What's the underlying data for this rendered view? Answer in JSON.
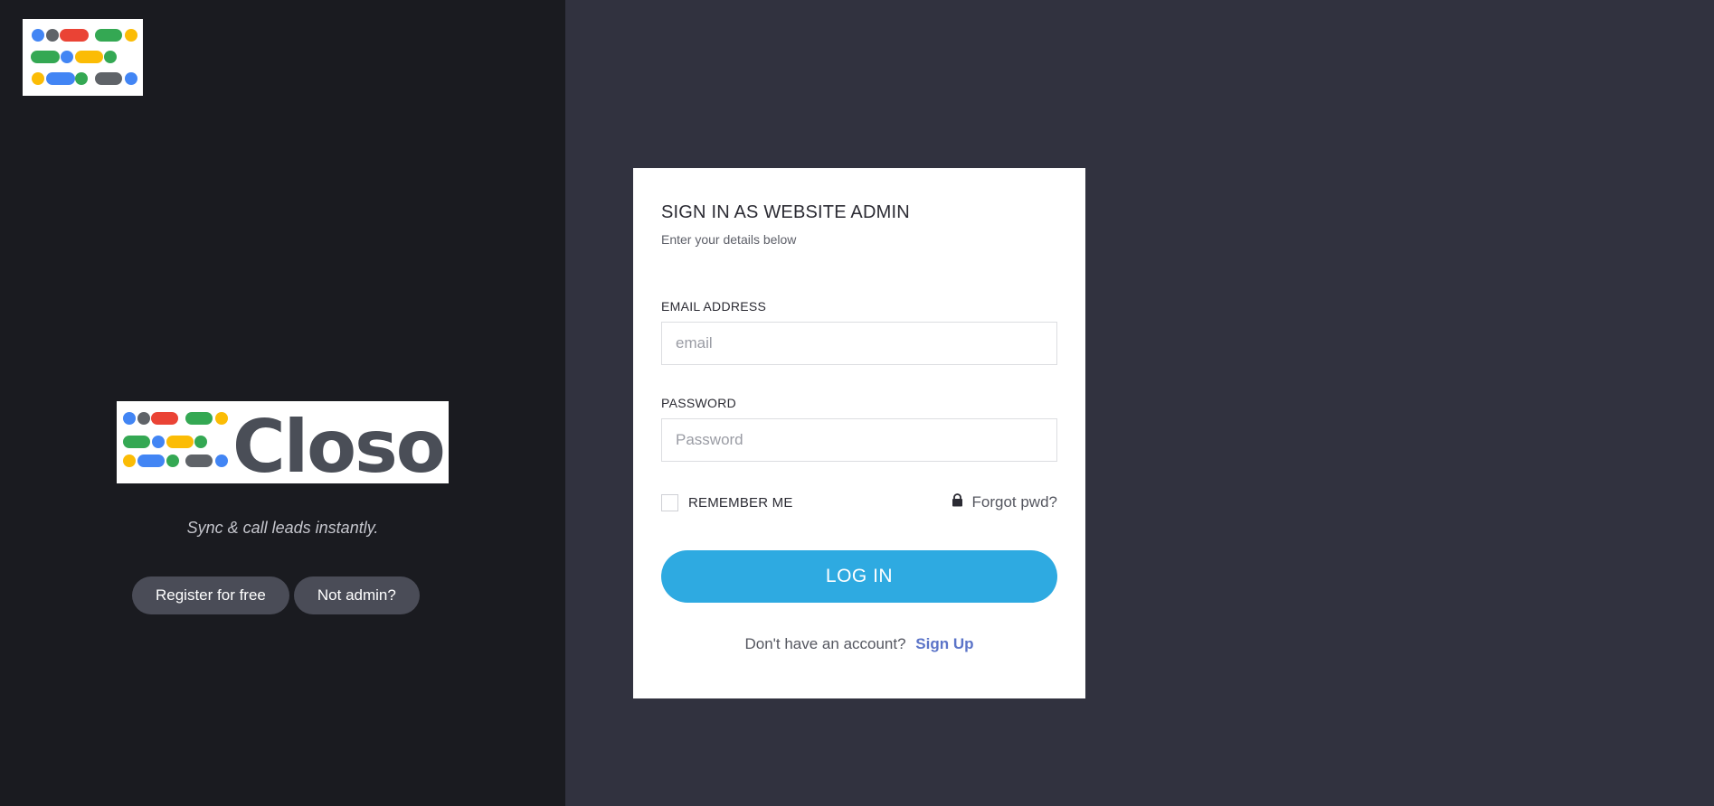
{
  "branding": {
    "brand_name": "Closor",
    "tagline": "Sync & call leads instantly."
  },
  "left_actions": {
    "register_label": "Register for free",
    "not_admin_label": "Not admin?"
  },
  "login_form": {
    "title": "SIGN IN AS WEBSITE ADMIN",
    "subtitle": "Enter your details below",
    "email_label": "EMAIL ADDRESS",
    "email_placeholder": "email",
    "email_value": "",
    "password_label": "PASSWORD",
    "password_placeholder": "Password",
    "password_value": "",
    "remember_label": "REMEMBER ME",
    "remember_checked": false,
    "forgot_label": "Forgot pwd?",
    "submit_label": "LOG IN",
    "signup_prompt": "Don't have an account?",
    "signup_link": "Sign Up"
  },
  "colors": {
    "left_panel_bg": "#1a1b20",
    "right_panel_bg": "#31323f",
    "primary_button": "#2eaae1",
    "link": "#5b74c8",
    "pill_button": "#4a4c57",
    "logo_blue": "#4285f4",
    "logo_red": "#ea4335",
    "logo_yellow": "#fbbc05",
    "logo_green": "#34a853",
    "logo_gray": "#5f6368"
  },
  "icons": {
    "logo_mark": "colored-dots-icon",
    "forgot": "lock-icon"
  }
}
